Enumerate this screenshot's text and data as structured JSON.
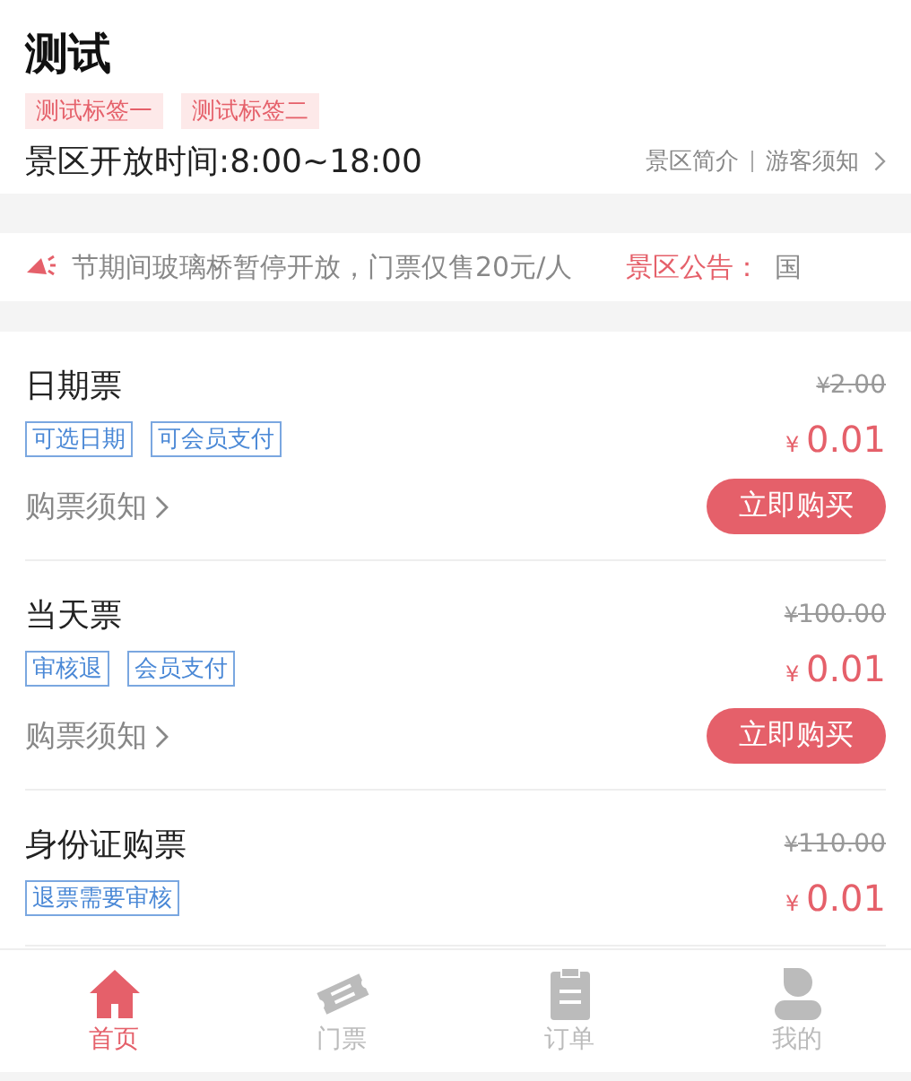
{
  "header": {
    "title": "测试",
    "tags": [
      "测试标签一",
      "测试标签二"
    ],
    "hours": "景区开放时间:8:00~18:00",
    "links": [
      "景区简介",
      "游客须知"
    ]
  },
  "notice": {
    "text": "节期间玻璃桥暂停开放，门票仅售20元/人",
    "label": "景区公告：",
    "next": "国"
  },
  "tickets": [
    {
      "name": "日期票",
      "tags": [
        "可选日期",
        "可会员支付"
      ],
      "original_price": "2.00",
      "price": "0.01",
      "currency": "¥",
      "notice": "购票须知",
      "button": "立即购买"
    },
    {
      "name": "当天票",
      "tags": [
        "审核退",
        "会员支付"
      ],
      "original_price": "100.00",
      "price": "0.01",
      "currency": "¥",
      "notice": "购票须知",
      "button": "立即购买"
    },
    {
      "name": "身份证购票",
      "tags": [
        "退票需要审核"
      ],
      "original_price": "110.00",
      "price": "0.01",
      "currency": "¥"
    }
  ],
  "tabbar": [
    {
      "label": "首页",
      "kind": "home",
      "selected": true
    },
    {
      "label": "门票",
      "kind": "ticket",
      "selected": false
    },
    {
      "label": "订单",
      "kind": "order",
      "selected": false
    },
    {
      "label": "我的",
      "kind": "me",
      "selected": false
    }
  ]
}
